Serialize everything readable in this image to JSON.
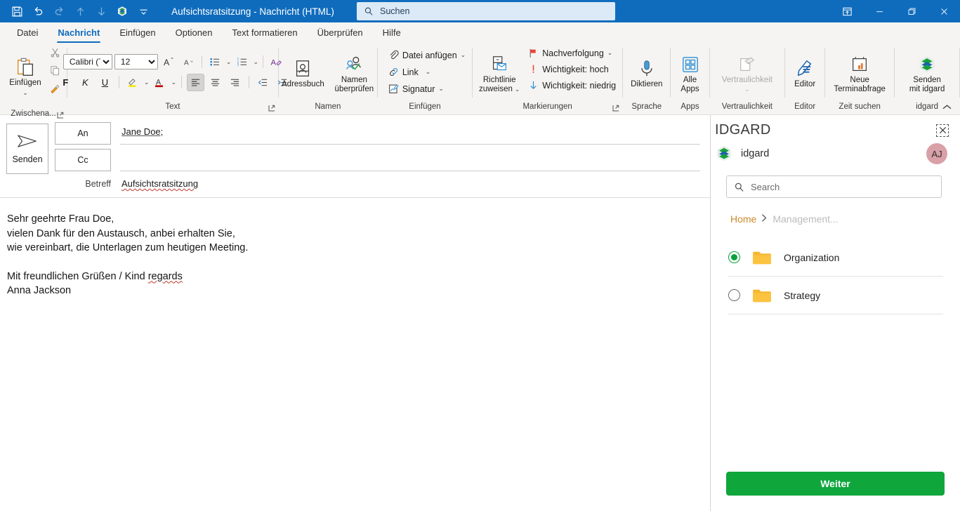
{
  "titlebar": {
    "quick_access": [
      {
        "name": "save-icon",
        "label": "Speichern"
      },
      {
        "name": "undo-icon",
        "label": "Rückgängig"
      },
      {
        "name": "redo-icon",
        "label": "Wiederholen"
      },
      {
        "name": "up-arrow-icon",
        "label": "Nach oben"
      },
      {
        "name": "down-arrow-icon",
        "label": "Nach unten"
      },
      {
        "name": "idgard-logo-icon",
        "label": "idgard"
      },
      {
        "name": "customize-qat-icon",
        "label": "Symbolleiste anpassen"
      }
    ],
    "title": "Aufsichtsratsitzung  -  Nachricht (HTML)",
    "search_placeholder": "Suchen",
    "window_controls": [
      {
        "name": "ribbon-display-options-icon",
        "label": "Menübandanzeigeoptionen"
      },
      {
        "name": "minimize-icon",
        "label": "Minimieren"
      },
      {
        "name": "restore-icon",
        "label": "Wiederherstellen"
      },
      {
        "name": "close-icon",
        "label": "Schließen"
      }
    ],
    "accent": "#0F6CBD"
  },
  "tabs": [
    {
      "label": "Datei",
      "active": false
    },
    {
      "label": "Nachricht",
      "active": true
    },
    {
      "label": "Einfügen",
      "active": false
    },
    {
      "label": "Optionen",
      "active": false
    },
    {
      "label": "Text formatieren",
      "active": false
    },
    {
      "label": "Überprüfen",
      "active": false
    },
    {
      "label": "Hilfe",
      "active": false
    }
  ],
  "ribbon": {
    "clipboard": {
      "group_label": "Zwischena...",
      "paste_label": "Einfügen",
      "cut_label": "Ausschneiden",
      "copy_label": "Kopieren",
      "format_painter_label": "Format übertragen"
    },
    "text": {
      "group_label": "Text",
      "font_name": "Calibri (T",
      "font_size": "12",
      "grow_font": "A",
      "shrink_font": "A",
      "bold": "F",
      "italic": "K",
      "underline": "U",
      "font_color_letter": "A",
      "highlight_letter": "A",
      "clear_format_letter": "A"
    },
    "names": {
      "group_label": "Namen",
      "address_book": "Adressbuch",
      "check_names_line1": "Namen",
      "check_names_line2": "überprüfen"
    },
    "insert": {
      "group_label": "Einfügen",
      "attach_file": "Datei anfügen",
      "link": "Link",
      "signature": "Signatur"
    },
    "tags": {
      "group_label": "Markierungen",
      "policy_line1": "Richtlinie",
      "policy_line2": "zuweisen",
      "follow_up": "Nachverfolgung",
      "high_importance": "Wichtigkeit: hoch",
      "low_importance": "Wichtigkeit: niedrig"
    },
    "speech": {
      "group_label": "Sprache",
      "dictate": "Diktieren"
    },
    "apps": {
      "group_label": "Apps",
      "all_apps_line1": "Alle",
      "all_apps_line2": "Apps"
    },
    "sensitivity": {
      "group_label": "Vertraulichkeit",
      "button": "Vertraulichkeit",
      "disabled": true
    },
    "editor": {
      "group_label": "Editor",
      "button": "Editor"
    },
    "findtime": {
      "group_label": "Zeit suchen",
      "line1": "Neue",
      "line2": "Terminabfrage"
    },
    "idgard": {
      "group_label": "idgard",
      "line1": "Senden",
      "line2": "mit idgard"
    },
    "collapse_label": "Menüband reduzieren"
  },
  "compose": {
    "send_button": "Senden",
    "to_button": "An",
    "to_value": "Jane Doe;",
    "cc_button": "Cc",
    "cc_value": "",
    "subject_label": "Betreff",
    "subject_value": "Aufsichtsratsitzung",
    "body_lines": [
      "Sehr geehrte Frau Doe,",
      "vielen Dank für den Austausch, anbei erhalten Sie,",
      "wie vereinbart, die Unterlagen zum heutigen Meeting.",
      "",
      "Mit freundlichen Grüßen / Kind regards",
      "Anna Jackson"
    ],
    "body_line_1": "Sehr geehrte Frau Doe,",
    "body_line_2": "vielen Dank für den Austausch, anbei erhalten Sie,",
    "body_line_3": "wie vereinbart, die Unterlagen zum heutigen Meeting.",
    "signoff_prefix": "Mit freundlichen Grüßen / Kind ",
    "signoff_misspelled": "regards",
    "sender_name": "Anna Jackson"
  },
  "panel": {
    "title": "IDGARD",
    "close_label": "×",
    "brand_name": "idgard",
    "avatar_initials": "AJ",
    "search_placeholder": "Search",
    "breadcrumb": {
      "home": "Home",
      "separator": "›",
      "current": "Management..."
    },
    "folders": [
      {
        "name": "Organization",
        "selected": true
      },
      {
        "name": "Strategy",
        "selected": false
      }
    ],
    "folder_0_name": "Organization",
    "folder_1_name": "Strategy",
    "primary_button": "Weiter",
    "colors": {
      "green": "#0FA63C",
      "folder_yellow": "#F5B731",
      "breadcrumb_orange": "#C98B2B",
      "avatar_bg": "#D9A0A8"
    }
  }
}
